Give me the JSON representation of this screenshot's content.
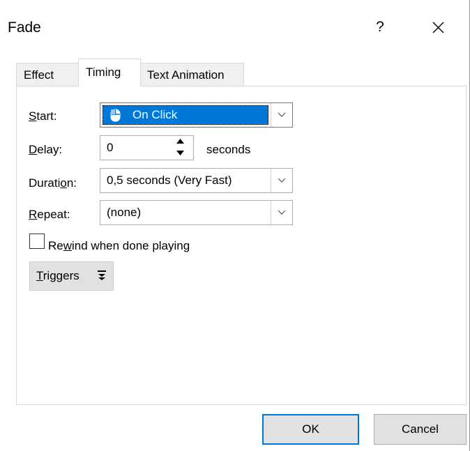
{
  "window": {
    "title": "Fade",
    "help": "?"
  },
  "tabs": [
    {
      "label": "Effect",
      "active": false
    },
    {
      "label": "Timing",
      "active": true
    },
    {
      "label": "Text Animation",
      "active": false
    }
  ],
  "timing": {
    "start": {
      "label_u": "S",
      "label_rest": "tart:",
      "value": "On Click",
      "icon": "mouse-icon"
    },
    "delay": {
      "label_u": "D",
      "label_rest": "elay:",
      "value": "0",
      "unit": "seconds"
    },
    "duration": {
      "label_pre": "Durati",
      "label_u": "o",
      "label_rest": "n:",
      "value": "0,5 seconds (Very Fast)"
    },
    "repeat": {
      "label_u": "R",
      "label_rest": "epeat:",
      "value": "(none)"
    },
    "rewind": {
      "label_pre": "Re",
      "label_u": "w",
      "label_rest": "ind when done playing",
      "checked": false
    },
    "triggers": {
      "label_u": "T",
      "label_rest": "riggers",
      "icon": "expand-down-icon"
    }
  },
  "buttons": {
    "ok": "OK",
    "cancel": "Cancel"
  },
  "colors": {
    "accent": "#0078d7",
    "button_bg": "#e1e1e1",
    "tab_bg": "#f0f0f0"
  }
}
